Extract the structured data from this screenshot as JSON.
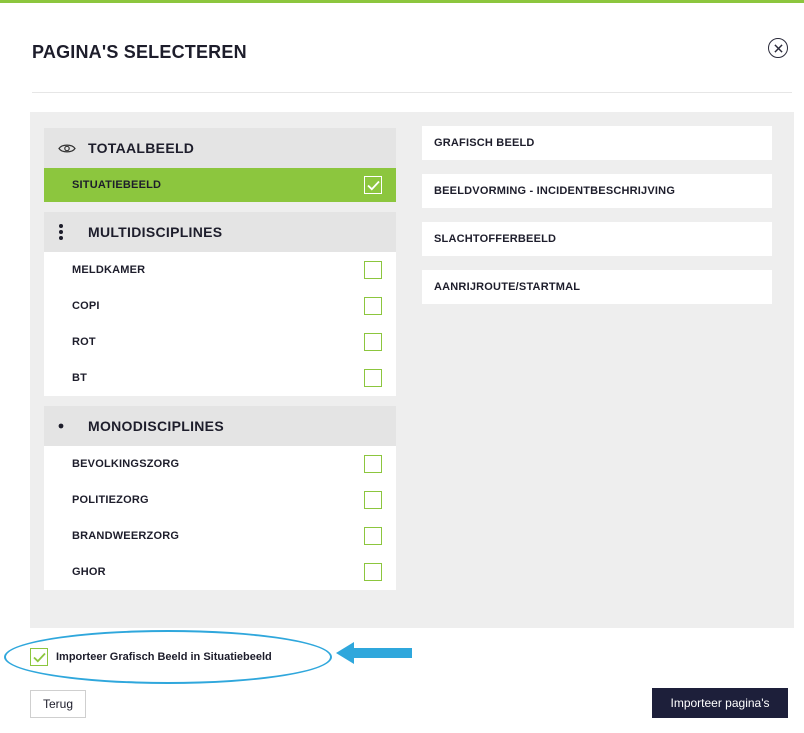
{
  "dialog": {
    "title": "PAGINA'S SELECTEREN",
    "close_icon": "close-circle-icon"
  },
  "groups": {
    "totaalbeeld": {
      "label": "TOTAALBEELD",
      "icon": "eye-icon",
      "items": [
        {
          "label": "SITUATIEBEELD",
          "checked": true
        }
      ]
    },
    "multidisciplines": {
      "label": "MULTIDISCIPLINES",
      "icon": "vertical-dots-icon",
      "items": [
        {
          "label": "MELDKAMER",
          "checked": false
        },
        {
          "label": "COPI",
          "checked": false
        },
        {
          "label": "ROT",
          "checked": false
        },
        {
          "label": "BT",
          "checked": false
        }
      ]
    },
    "monodisciplines": {
      "label": "MONODISCIPLINES",
      "icon": "bullet-icon",
      "items": [
        {
          "label": "BEVOLKINGSZORG",
          "checked": false
        },
        {
          "label": "POLITIEZORG",
          "checked": false
        },
        {
          "label": "BRANDWEERZORG",
          "checked": false
        },
        {
          "label": "GHOR",
          "checked": false
        }
      ]
    }
  },
  "pages": [
    {
      "label": "GRAFISCH BEELD"
    },
    {
      "label": "BEELDVORMING - INCIDENTBESCHRIJVING"
    },
    {
      "label": "SLACHTOFFERBEELD"
    },
    {
      "label": "AANRIJROUTE/STARTMAL"
    }
  ],
  "import_option": {
    "label": "Importeer Grafisch Beeld in Situatiebeeld",
    "checked": true
  },
  "buttons": {
    "back": "Terug",
    "import": "Importeer pagina's"
  },
  "colors": {
    "accent_green": "#8cc63e",
    "primary_dark": "#1d1f3a",
    "annotation_blue": "#2fa7dc",
    "panel_gray": "#eeeeee"
  }
}
